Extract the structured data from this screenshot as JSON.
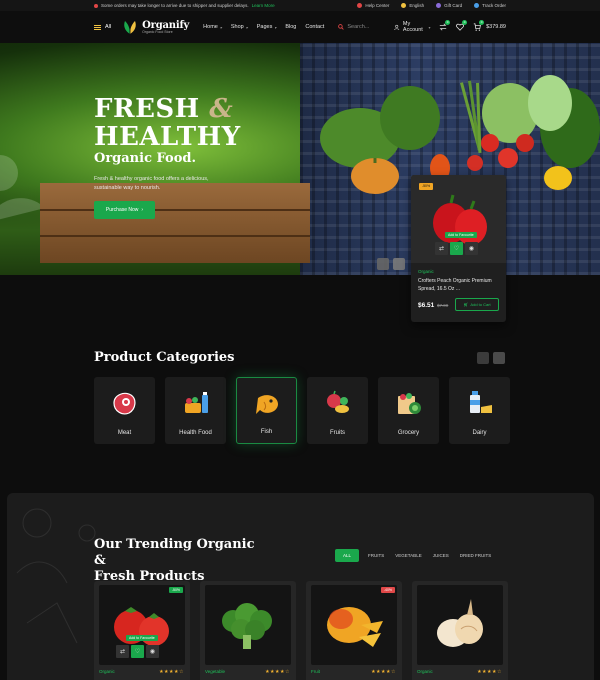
{
  "topbar": {
    "notice": "Some orders may take longer to arrive due to shipper and supplier delays.",
    "notice_link": "Learn More",
    "links": [
      {
        "label": "Help Center",
        "icon": "help-icon",
        "color": "#e14646"
      },
      {
        "label": "English",
        "icon": "globe-icon",
        "color": "#f0c140"
      },
      {
        "label": "Gift Card",
        "icon": "gift-icon",
        "color": "#8a6bd8"
      },
      {
        "label": "Track Order",
        "icon": "truck-icon",
        "color": "#4a9fe8"
      }
    ]
  },
  "header": {
    "all_label": "All",
    "brand": "Organify",
    "tagline": "Organic Food Store",
    "nav": [
      {
        "label": "Home",
        "dropdown": true
      },
      {
        "label": "Shop",
        "dropdown": true
      },
      {
        "label": "Pages",
        "dropdown": true
      },
      {
        "label": "Blog",
        "dropdown": false
      },
      {
        "label": "Contact",
        "dropdown": false
      }
    ],
    "search_placeholder": "Search...",
    "account_label": "My Account",
    "compare_count": "0",
    "wishlist_count": "0",
    "cart_count": "0",
    "cart_total": "$379.89"
  },
  "hero": {
    "title_line1_a": "FRESH",
    "title_amp": "&",
    "title_line2": "HEALTHY",
    "subtitle": "Organic Food.",
    "description": "Fresh & healthy organic food offers a delicious, sustainable way to nourish.",
    "cta": "Purchase Now",
    "card": {
      "tag": "-50%",
      "favourite_label": "Add to Favourite",
      "category": "Organic",
      "name": "Crofters Peach Organic Premium Spread, 16.5 Oz ...",
      "price": "$6.51",
      "old_price": "$7.00",
      "cart_label": "Add to Cart"
    }
  },
  "categories": {
    "title": "Product Categories",
    "items": [
      {
        "label": "Meat",
        "icon": "meat-icon"
      },
      {
        "label": "Health Food",
        "icon": "health-food-icon"
      },
      {
        "label": "Fish",
        "icon": "fish-icon",
        "active": true
      },
      {
        "label": "Fruits",
        "icon": "fruits-icon"
      },
      {
        "label": "Grocery",
        "icon": "grocery-icon"
      },
      {
        "label": "Dairy",
        "icon": "dairy-icon"
      }
    ]
  },
  "trending": {
    "title_line1": "Our Trending Organic &",
    "title_line2": "Fresh Products",
    "filters": [
      "ALL",
      "FRUITS",
      "VEGETABLE",
      "JUICES",
      "DRIED FRUITS"
    ],
    "active_filter": "ALL",
    "products": [
      {
        "category": "Organic",
        "discount": "-50%",
        "discount_color": "#1aa84c",
        "favourite_label": "Add to Favourite",
        "image": "tomato"
      },
      {
        "category": "Vegetable",
        "discount": "",
        "image": "broccoli"
      },
      {
        "category": "Fruit",
        "discount": "-40%",
        "discount_color": "#e04848",
        "image": "mango"
      },
      {
        "category": "Organic",
        "discount": "",
        "image": "onion"
      }
    ],
    "stars": "★★★★☆"
  }
}
